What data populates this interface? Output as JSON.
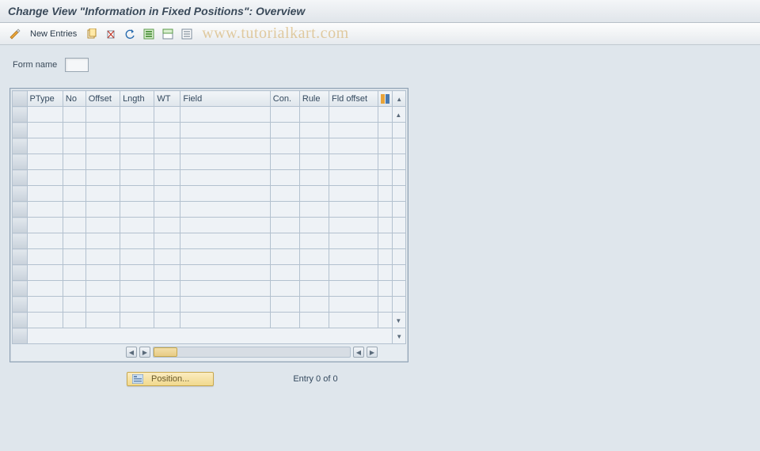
{
  "title": "Change View \"Information in Fixed Positions\": Overview",
  "toolbar": {
    "new_entries_label": "New Entries"
  },
  "watermark": "www.tutorialkart.com",
  "form": {
    "name_label": "Form name",
    "name_value": ""
  },
  "table": {
    "columns": [
      "PType",
      "No",
      "Offset",
      "Lngth",
      "WT",
      "Field",
      "Con.",
      "Rule",
      "Fld offset"
    ],
    "rows": 15
  },
  "footer": {
    "position_label": "Position...",
    "entry_text": "Entry 0 of 0"
  }
}
